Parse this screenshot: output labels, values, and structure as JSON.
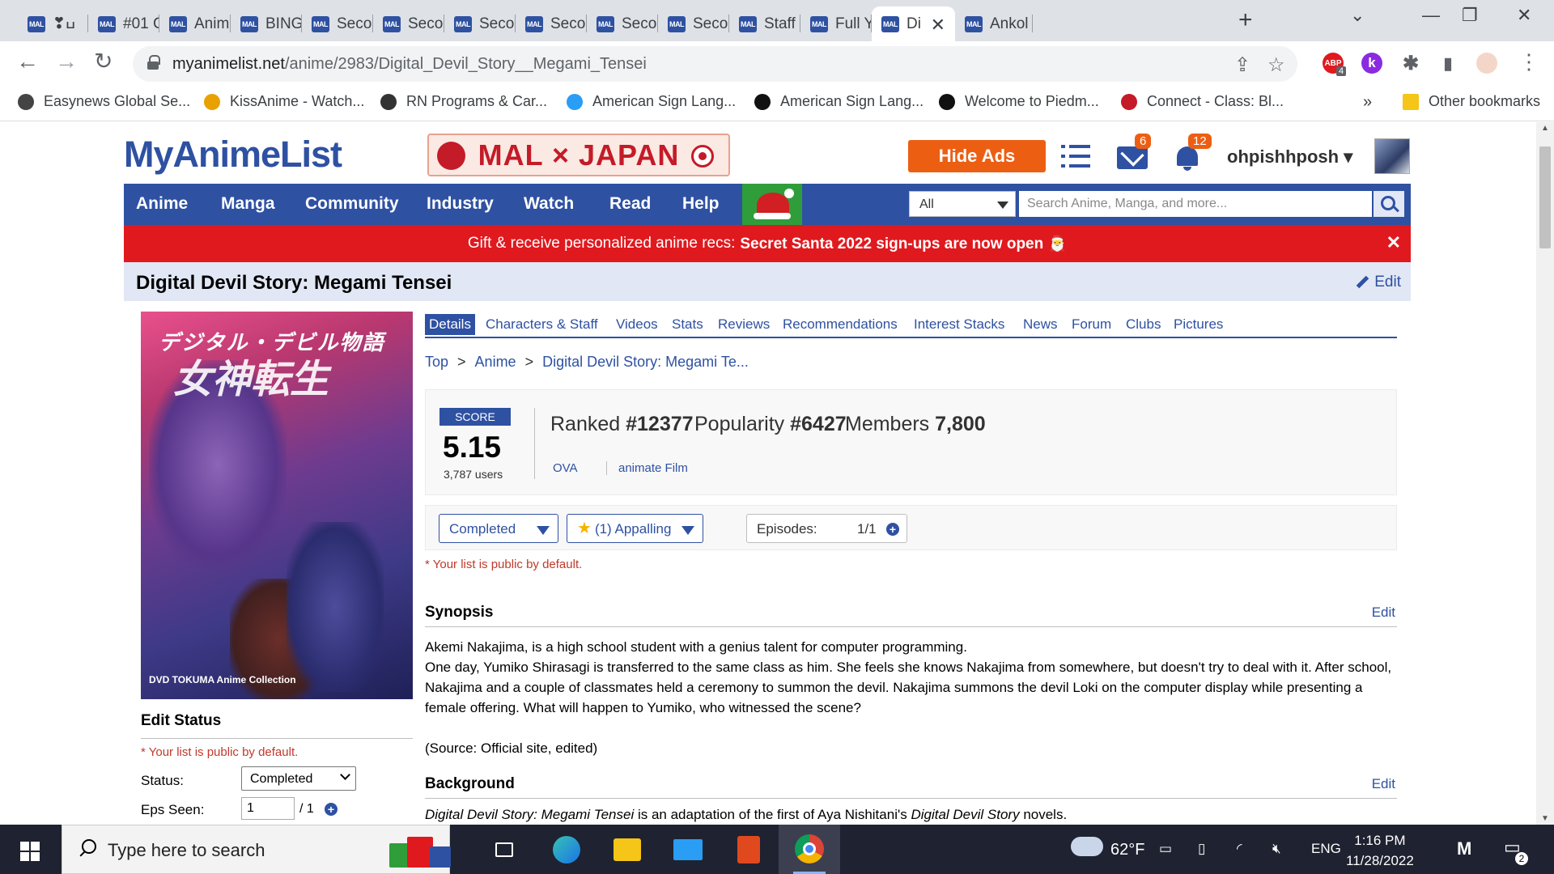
{
  "browser": {
    "tabs": [
      {
        "favicon": "MAL",
        "title": "❣︎ߎ"
      },
      {
        "favicon": "MAL",
        "title": "#01 C"
      },
      {
        "favicon": "MAL",
        "title": "Anime"
      },
      {
        "favicon": "MAL",
        "title": "BINGO"
      },
      {
        "favicon": "MAL",
        "title": "Secon"
      },
      {
        "favicon": "MAL",
        "title": "Secon"
      },
      {
        "favicon": "MAL",
        "title": "Secon"
      },
      {
        "favicon": "MAL",
        "title": "Secon"
      },
      {
        "favicon": "MAL",
        "title": "Secon"
      },
      {
        "favicon": "MAL",
        "title": "Secon"
      },
      {
        "favicon": "MAL",
        "title": "Staff"
      },
      {
        "favicon": "MAL",
        "title": "Full Y"
      },
      {
        "favicon": "MAL",
        "title": "Di",
        "active": true
      },
      {
        "favicon": "MAL",
        "title": "Ankol"
      }
    ],
    "new_tab": "+",
    "close_tab": "✕",
    "window_controls": {
      "tab_search": "⌄",
      "minimize": "—",
      "restore": "❐",
      "close": "✕"
    },
    "nav": {
      "back": "←",
      "forward": "→",
      "reload": "↻"
    },
    "url_host": "myanimelist.net",
    "url_path": "/anime/2983/Digital_Devil_Story__Megami_Tensei",
    "omnibox_icons": {
      "share": "⇪",
      "star": "☆"
    },
    "extensions": [
      {
        "name": "abp",
        "label": "ABP",
        "badge": "4",
        "color": "#e0191e"
      },
      {
        "name": "k",
        "label": "k",
        "color": "#8a2be2"
      },
      {
        "name": "puzzle",
        "label": "✱",
        "color": "#5f6368"
      },
      {
        "name": "sidepanel",
        "label": "▮",
        "color": "#5f6368"
      }
    ],
    "menu_dots": "⋮",
    "bookmarks": [
      {
        "label": "Easynews Global Se...",
        "color": "#444"
      },
      {
        "label": "KissAnime - Watch...",
        "color": "#e8a100"
      },
      {
        "label": "RN Programs & Car...",
        "color": "#333"
      },
      {
        "label": "American Sign Lang...",
        "color": "#2a9df4"
      },
      {
        "label": "American Sign Lang...",
        "color": "#111"
      },
      {
        "label": "Welcome to Piedm...",
        "color": "#111"
      },
      {
        "label": "Connect - Class: Bl...",
        "color": "#c41b28"
      }
    ],
    "bookmarks_more": "»",
    "other_bookmarks": "Other bookmarks"
  },
  "site": {
    "logo": "MyAnimeList",
    "banner": "MAL × JAPAN",
    "hide_ads": "Hide Ads",
    "mail_badge": "6",
    "notif_badge": "12",
    "username": "ohpishhposh",
    "user_caret": "▾",
    "nav": [
      "Anime",
      "Manga",
      "Community",
      "Industry",
      "Watch",
      "Read",
      "Help"
    ],
    "search_scope": "All",
    "search_placeholder": "Search Anime, Manga, and more...",
    "promo_text": "Gift & receive personalized anime recs:",
    "promo_bold": "Secret Santa 2022 sign-ups are now open 🎅",
    "promo_close": "✕"
  },
  "anime": {
    "title": "Digital Devil Story: Megami Tensei",
    "edit": "Edit",
    "cover_jp_small": "デジタル・デビル物語",
    "cover_jp_big": "女神転生",
    "cover_dvd": "DVD  TOKUMA Anime Collection",
    "tabs": [
      "Details",
      "Characters & Staff",
      "Videos",
      "Stats",
      "Reviews",
      "Recommendations",
      "Interest Stacks",
      "News",
      "Forum",
      "Clubs",
      "Pictures"
    ],
    "breadcrumb": [
      "Top",
      "Anime",
      "Digital Devil Story: Megami Te..."
    ],
    "score_label": "SCORE",
    "score": "5.15",
    "score_users": "3,787 users",
    "ranked_label": "Ranked",
    "ranked": "#12377",
    "popularity_label": "Popularity",
    "popularity": "#6427",
    "members_label": "Members",
    "members": "7,800",
    "type": "OVA",
    "studio": "animate Film",
    "list_status": "Completed",
    "list_score": "(1) Appalling",
    "episodes_label": "Episodes:",
    "episodes": "1/1",
    "public_note": "* Your list is public by default.",
    "synopsis_h": "Synopsis",
    "section_edit": "Edit",
    "synopsis_1": "Akemi Nakajima, is a high school student with a genius talent for computer programming.",
    "synopsis_2": "One day, Yumiko Shirasagi is transferred to the same class as him. She feels she knows Nakajima from somewhere, but doesn't try to deal with it. After school, Nakajima and a couple of classmates held a ceremony to summon the devil. Nakajima summons the devil Loki on the computer display while presenting a female offering. What will happen to Yumiko, who witnessed the scene?",
    "synopsis_source": "(Source: Official site, edited)",
    "background_h": "Background",
    "background_em1": "Digital Devil Story: Megami Tensei",
    "background_mid": " is an adaptation of the first of Aya Nishitani's ",
    "background_em2": "Digital Devil Story",
    "background_end": " novels.",
    "edit_status_h": "Edit Status",
    "status_label": "Status:",
    "status_value": "Completed",
    "eps_seen_label": "Eps Seen:",
    "eps_seen_value": "1",
    "eps_total": "/ 1"
  },
  "taskbar": {
    "search_text": "Type here to search",
    "weather": "62°F",
    "lang": "ENG",
    "time": "1:16 PM",
    "date": "11/28/2022",
    "notif_count": "2"
  }
}
